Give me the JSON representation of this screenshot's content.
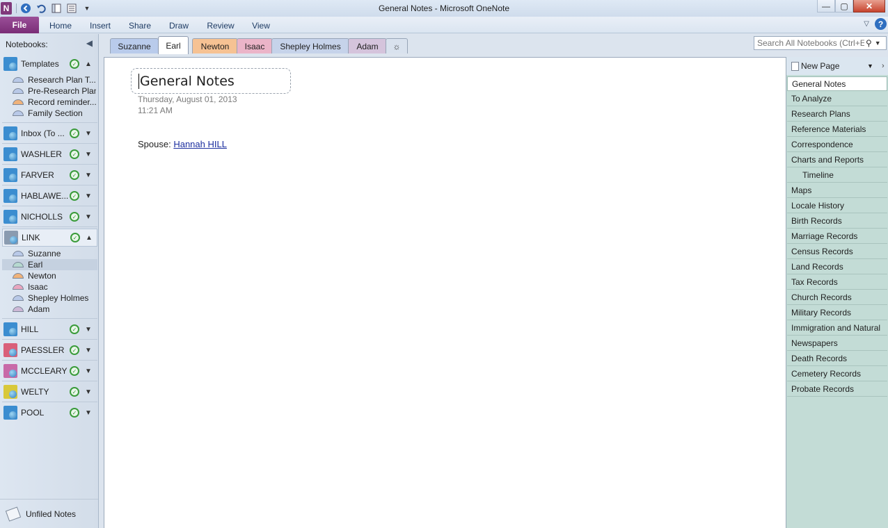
{
  "window": {
    "title": "General Notes  -  Microsoft OneNote",
    "app_logo": "N",
    "controls": {
      "minimize": "—",
      "maximize": "▢",
      "close": "✕"
    }
  },
  "ribbon": {
    "tabs": [
      "File",
      "Home",
      "Insert",
      "Share",
      "Draw",
      "Review",
      "View"
    ],
    "help": "?"
  },
  "sidebar": {
    "header": "Notebooks:",
    "notebooks": [
      {
        "label": "Templates",
        "color": "#3b8dd0",
        "expanded": true
      },
      {
        "label": "Inbox (To ...",
        "color": "#3b8dd0",
        "expanded": false
      },
      {
        "label": "WASHLER",
        "color": "#3b8dd0",
        "expanded": false
      },
      {
        "label": "FARVER",
        "color": "#3b8dd0",
        "expanded": false
      },
      {
        "label": "HABLAWE...",
        "color": "#3b8dd0",
        "expanded": false
      },
      {
        "label": "NICHOLLS",
        "color": "#3b8dd0",
        "expanded": false
      },
      {
        "label": "LINK",
        "color": "#8a9bb0",
        "expanded": true
      },
      {
        "label": "HILL",
        "color": "#3b8dd0",
        "expanded": false
      },
      {
        "label": "PAESSLER",
        "color": "#d9607a",
        "expanded": false
      },
      {
        "label": "MCCLEARY",
        "color": "#c86aa8",
        "expanded": false
      },
      {
        "label": "WELTY",
        "color": "#d8c83a",
        "expanded": false
      },
      {
        "label": "POOL",
        "color": "#3b8dd0",
        "expanded": false
      }
    ],
    "template_sections": [
      {
        "label": "Research Plan  T...",
        "color": "#b9c9e8"
      },
      {
        "label": "Pre-Research Plan",
        "color": "#b9c9e8"
      },
      {
        "label": "Record reminder...",
        "color": "#f0b27a"
      },
      {
        "label": "Family Section",
        "color": "#b9c9e8"
      }
    ],
    "link_sections": [
      {
        "label": "Suzanne",
        "color": "#b9c9e8"
      },
      {
        "label": "Earl",
        "color": "#b6d9cf"
      },
      {
        "label": "Newton",
        "color": "#f0b27a"
      },
      {
        "label": "Isaac",
        "color": "#e9a6bf"
      },
      {
        "label": "Shepley Holmes",
        "color": "#b9c9e8"
      },
      {
        "label": "Adam",
        "color": "#cdb8d6"
      }
    ],
    "unfiled": "Unfiled Notes"
  },
  "section_tabs": [
    {
      "label": "Suzanne",
      "color": "#b9cbeb"
    },
    {
      "label": "Earl",
      "color": "#ffffff"
    },
    {
      "label": "Newton",
      "color": "#f6c293"
    },
    {
      "label": "Isaac",
      "color": "#ebb4c8"
    },
    {
      "label": "Shepley Holmes",
      "color": "#c6d3ea"
    },
    {
      "label": "Adam",
      "color": "#d5c4dc"
    },
    {
      "label": "☼",
      "color": "#d9e2ee"
    }
  ],
  "search": {
    "placeholder": "Search All Notebooks (Ctrl+E)"
  },
  "page": {
    "title": "General Notes",
    "date": "Thursday, August 01, 2013",
    "time": "11:21 AM",
    "spouse_label": "Spouse: ",
    "spouse_link": "Hannah HILL"
  },
  "pagelist": {
    "new_page": "New Page",
    "pages": [
      {
        "label": "General Notes",
        "active": true,
        "sub": false
      },
      {
        "label": "To Analyze",
        "active": false,
        "sub": false
      },
      {
        "label": "Research Plans",
        "active": false,
        "sub": false
      },
      {
        "label": "Reference Materials",
        "active": false,
        "sub": false
      },
      {
        "label": "Correspondence",
        "active": false,
        "sub": false
      },
      {
        "label": "Charts and Reports",
        "active": false,
        "sub": false
      },
      {
        "label": "Timeline",
        "active": false,
        "sub": true
      },
      {
        "label": "Maps",
        "active": false,
        "sub": false
      },
      {
        "label": "Locale History",
        "active": false,
        "sub": false
      },
      {
        "label": "Birth Records",
        "active": false,
        "sub": false
      },
      {
        "label": "Marriage Records",
        "active": false,
        "sub": false
      },
      {
        "label": "Census Records",
        "active": false,
        "sub": false
      },
      {
        "label": "Land Records",
        "active": false,
        "sub": false
      },
      {
        "label": "Tax Records",
        "active": false,
        "sub": false
      },
      {
        "label": "Church Records",
        "active": false,
        "sub": false
      },
      {
        "label": "Military Records",
        "active": false,
        "sub": false
      },
      {
        "label": "Immigration and Natural",
        "active": false,
        "sub": false
      },
      {
        "label": "Newspapers",
        "active": false,
        "sub": false
      },
      {
        "label": "Death Records",
        "active": false,
        "sub": false
      },
      {
        "label": "Cemetery Records",
        "active": false,
        "sub": false
      },
      {
        "label": "Probate Records",
        "active": false,
        "sub": false
      }
    ]
  }
}
